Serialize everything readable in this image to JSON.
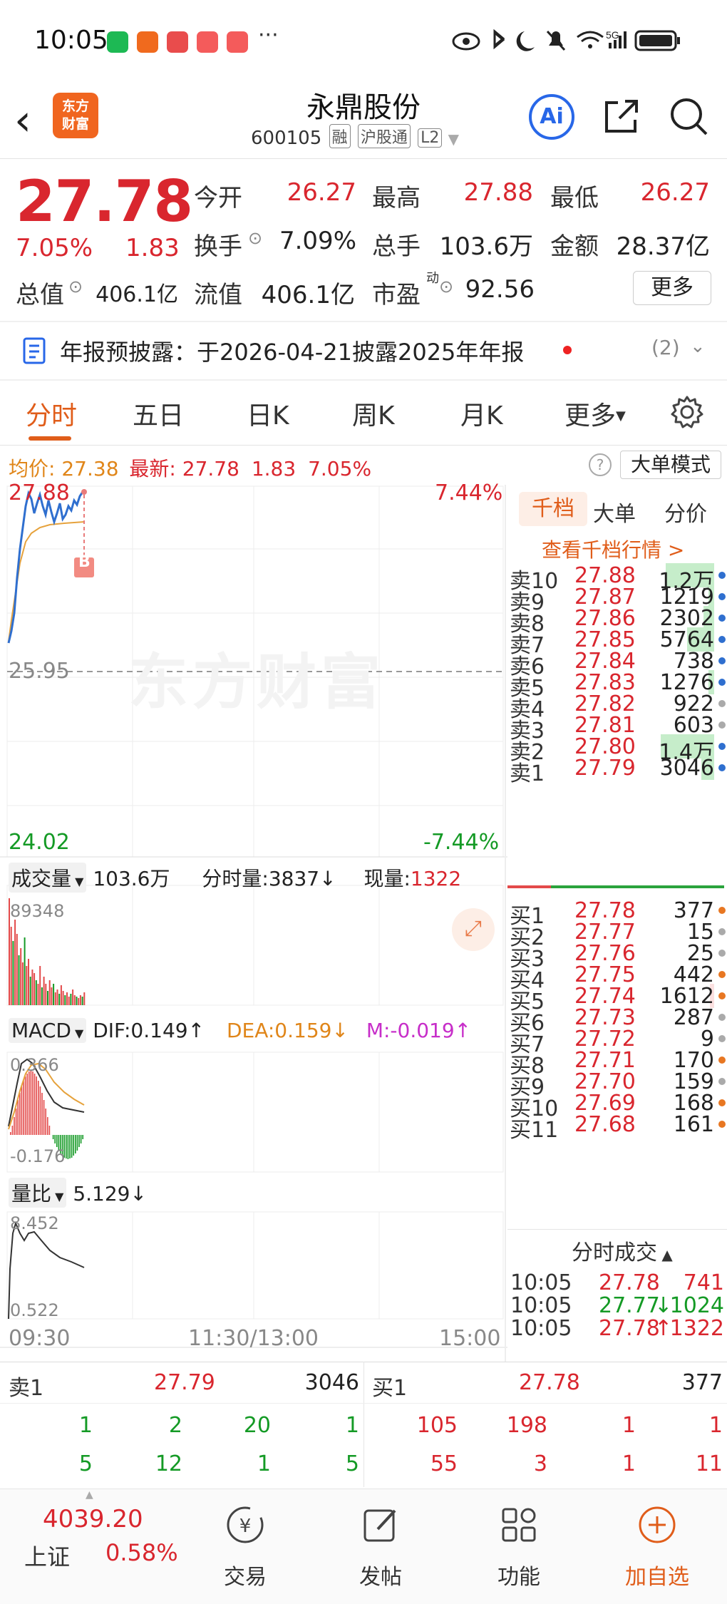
{
  "status_bar": {
    "time": "10:05",
    "dots": "···",
    "network": "5G"
  },
  "header": {
    "logo_text_1": "东方",
    "logo_text_2": "财富",
    "title": "永鼎股份",
    "code": "600105",
    "tags": [
      "融",
      "沪股通",
      "L2"
    ],
    "ai_label": "Ai"
  },
  "quote": {
    "price": "27.78",
    "change_pct": "7.05%",
    "change": "1.83",
    "open_label": "今开",
    "open": "26.27",
    "high_label": "最高",
    "high": "27.88",
    "low_label": "最低",
    "low": "26.27",
    "turnover_label": "换手",
    "turnover": "7.09%",
    "volume_label": "总手",
    "volume": "103.6万",
    "amount_label": "金额",
    "amount": "28.37亿",
    "mktcap_label": "总值",
    "mktcap": "406.1亿",
    "float_label": "流值",
    "float": "406.1亿",
    "pe_label": "市盈",
    "pe_sup": "动",
    "pe": "92.56",
    "more": "更多"
  },
  "notice": {
    "text": "年报预披露：于2026-04-21披露2025年年报",
    "count": "(2)"
  },
  "tabs": [
    "分时",
    "五日",
    "日K",
    "周K",
    "月K",
    "更多"
  ],
  "info_line": {
    "avg_label": "均价:",
    "avg": "27.38",
    "latest_label": "最新:",
    "latest": "27.78",
    "chg": "1.83",
    "pct": "7.05%",
    "mode": "大单模式",
    "help": "?"
  },
  "price_chart": {
    "top_price": "27.88",
    "top_pct": "7.44%",
    "mid_price": "25.95",
    "bottom_price": "24.02",
    "bottom_pct": "-7.44%",
    "marker": "B",
    "watermark": "东方财富"
  },
  "volume_panel": {
    "selector": "成交量",
    "total": "103.6万",
    "tick_label": "分时量:3837↓",
    "now_label": "现量:",
    "now": "1322",
    "max": "89348"
  },
  "macd_panel": {
    "selector": "MACD",
    "dif": "DIF:0.149↑",
    "dea": "DEA:0.159↓",
    "m": "M:-0.019↑",
    "top": "0.366",
    "bottom": "-0.176"
  },
  "ratio_panel": {
    "selector": "量比",
    "value": "5.129↓",
    "top": "8.452",
    "bottom": "0.522"
  },
  "time_axis": [
    "09:30",
    "11:30/13:00",
    "15:00"
  ],
  "book": {
    "tabs": [
      "千档",
      "大单",
      "分价"
    ],
    "link": "查看千档行情 >",
    "asks": [
      {
        "label": "卖10",
        "price": "27.88",
        "vol": "1.2万",
        "bar": 0.45,
        "dot": "#2f6fcf"
      },
      {
        "label": "卖9",
        "price": "27.87",
        "vol": "1219",
        "bar": 0.05,
        "dot": "#2f6fcf"
      },
      {
        "label": "卖8",
        "price": "27.86",
        "vol": "2302",
        "bar": 0.1,
        "dot": "#2f6fcf"
      },
      {
        "label": "卖7",
        "price": "27.85",
        "vol": "5764",
        "bar": 0.25,
        "dot": "#2f6fcf"
      },
      {
        "label": "卖6",
        "price": "27.84",
        "vol": "738",
        "bar": 0,
        "dot": "#2f6fcf"
      },
      {
        "label": "卖5",
        "price": "27.83",
        "vol": "1276",
        "bar": 0.05,
        "dot": "#2f6fcf"
      },
      {
        "label": "卖4",
        "price": "27.82",
        "vol": "922",
        "bar": 0,
        "dot": "#aaaaaa"
      },
      {
        "label": "卖3",
        "price": "27.81",
        "vol": "603",
        "bar": 0,
        "dot": "#aaaaaa"
      },
      {
        "label": "卖2",
        "price": "27.80",
        "vol": "1.4万",
        "bar": 0.5,
        "dot": "#2f6fcf"
      },
      {
        "label": "卖1",
        "price": "27.79",
        "vol": "3046",
        "bar": 0.12,
        "dot": "#2f6fcf"
      }
    ],
    "bids": [
      {
        "label": "买1",
        "price": "27.78",
        "vol": "377",
        "bar": 0,
        "dot": "#e87722"
      },
      {
        "label": "买2",
        "price": "27.77",
        "vol": "15",
        "bar": 0,
        "dot": "#aaaaaa"
      },
      {
        "label": "买3",
        "price": "27.76",
        "vol": "25",
        "bar": 0,
        "dot": "#aaaaaa"
      },
      {
        "label": "买4",
        "price": "27.75",
        "vol": "442",
        "bar": 0,
        "dot": "#e87722"
      },
      {
        "label": "买5",
        "price": "27.74",
        "vol": "1612",
        "bar": 0.04,
        "dot": "#e87722"
      },
      {
        "label": "买6",
        "price": "27.73",
        "vol": "287",
        "bar": 0,
        "dot": "#aaaaaa"
      },
      {
        "label": "买7",
        "price": "27.72",
        "vol": "9",
        "bar": 0,
        "dot": "#aaaaaa"
      },
      {
        "label": "买8",
        "price": "27.71",
        "vol": "170",
        "bar": 0,
        "dot": "#e87722"
      },
      {
        "label": "买9",
        "price": "27.70",
        "vol": "159",
        "bar": 0,
        "dot": "#aaaaaa"
      },
      {
        "label": "买10",
        "price": "27.69",
        "vol": "168",
        "bar": 0,
        "dot": "#e87722"
      },
      {
        "label": "买11",
        "price": "27.68",
        "vol": "161",
        "bar": 0,
        "dot": "#e87722"
      }
    ],
    "trades_title": "分时成交",
    "trades": [
      {
        "time": "10:05",
        "price": "27.78",
        "vol": "741",
        "dir": "",
        "color": "#d9262e"
      },
      {
        "time": "10:05",
        "price": "27.77",
        "vol": "1024",
        "dir": "↓",
        "color": "#149a25"
      },
      {
        "time": "10:05",
        "price": "27.78",
        "vol": "1322",
        "dir": "↑",
        "color": "#d9262e"
      }
    ]
  },
  "summary": {
    "ask_label": "卖1",
    "ask_price": "27.79",
    "ask_vol": "3046",
    "bid_label": "买1",
    "bid_price": "27.78",
    "bid_vol": "377",
    "ask_queue_1": [
      "1",
      "2",
      "20",
      "1"
    ],
    "ask_queue_2": [
      "5",
      "12",
      "1",
      "5"
    ],
    "bid_queue_1": [
      "105",
      "198",
      "1",
      "1"
    ],
    "bid_queue_2": [
      "55",
      "3",
      "1",
      "11"
    ]
  },
  "dock": {
    "index_value": "4039.20",
    "index_name": "上证",
    "index_pct": "0.58%",
    "items": [
      "交易",
      "发帖",
      "功能",
      "加自选"
    ]
  },
  "colors": {
    "up": "#d9262e",
    "down": "#149a25",
    "accent": "#e05d1a",
    "avg_line": "#e6a23c",
    "price_line": "#2f6fcf"
  }
}
